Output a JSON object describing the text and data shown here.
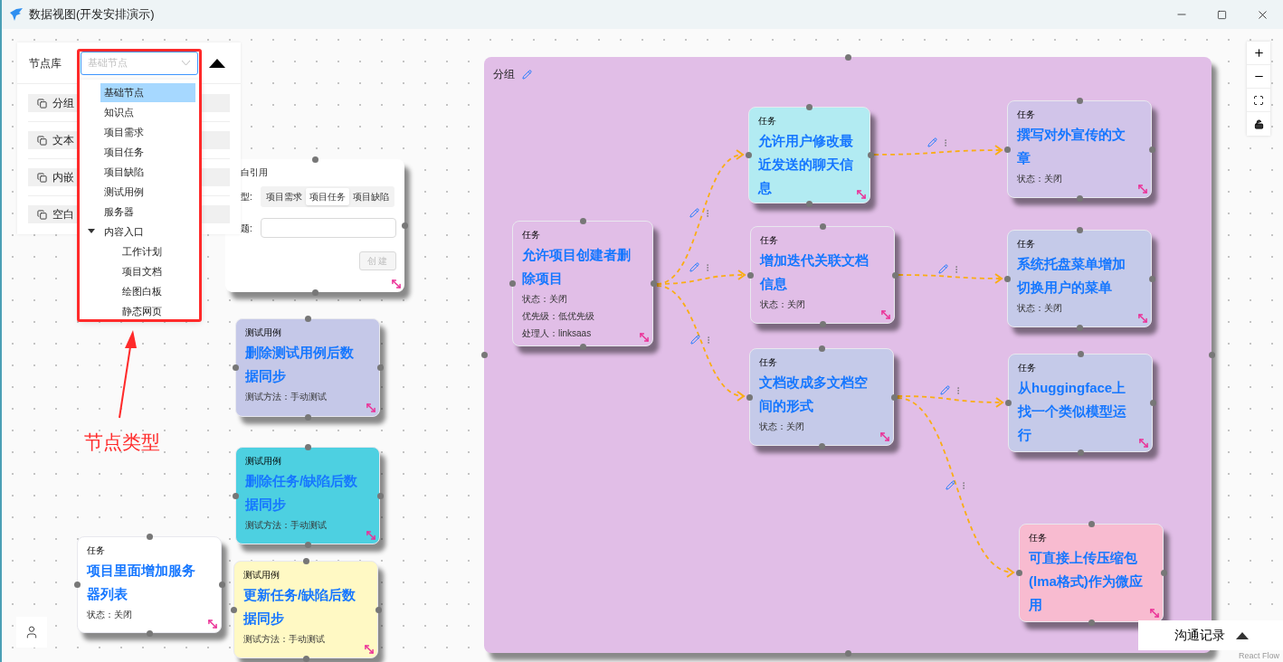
{
  "window": {
    "title": "数据视图(开发安排演示)"
  },
  "node_library": {
    "title": "节点库",
    "select": {
      "value": "基础节点"
    },
    "items": [
      {
        "label": "分组"
      },
      {
        "label": "文本"
      },
      {
        "label": "内嵌"
      },
      {
        "label": "空白"
      }
    ]
  },
  "type_dropdown": {
    "options": [
      {
        "label": "基础节点",
        "selected": true
      },
      {
        "label": "知识点",
        "selected": false
      },
      {
        "label": "项目需求",
        "selected": false
      },
      {
        "label": "项目任务",
        "selected": false
      },
      {
        "label": "项目缺陷",
        "selected": false
      },
      {
        "label": "测试用例",
        "selected": false
      },
      {
        "label": "服务器",
        "selected": false
      },
      {
        "label": "内容入口",
        "selected": false,
        "expanded": true,
        "children": [
          {
            "label": "工作计划",
            "selected": false
          },
          {
            "label": "项目文档",
            "selected": false
          },
          {
            "label": "绘图白板",
            "selected": false
          },
          {
            "label": "静态网页",
            "selected": false
          }
        ]
      }
    ]
  },
  "annotation": {
    "label": "节点类型"
  },
  "free_nodes": [
    {
      "kind": "ref_form",
      "title": "白引用",
      "type_label": "型:",
      "tabs": [
        {
          "label": "项目需求",
          "selected": false
        },
        {
          "label": "项目任务",
          "selected": true
        },
        {
          "label": "项目缺陷",
          "selected": false
        }
      ],
      "field_label": "题:",
      "button": {
        "label": "创建",
        "disabled": true
      }
    },
    {
      "kind": "test_case",
      "label": "测试用例",
      "title": "删除测试用例后数据同步",
      "lines": [
        "测试方法：手动测试"
      ],
      "color": "#c5c8e8"
    },
    {
      "kind": "test_case",
      "label": "测试用例",
      "title": "删除任务/缺陷后数据同步",
      "lines": [
        "测试方法：手动测试"
      ],
      "color": "#4dd0e1"
    },
    {
      "kind": "test_case",
      "label": "测试用例",
      "title": "更新任务/缺陷后数据同步",
      "lines": [
        "测试方法：手动测试"
      ],
      "color": "#fff9c4"
    },
    {
      "kind": "task",
      "label": "任务",
      "title": "项目里面增加服务器列表",
      "lines": [
        "状态：关闭"
      ],
      "color": "#ffffff"
    }
  ],
  "group": {
    "label": "分组",
    "color": "#e1bee7",
    "nodes": [
      {
        "kind": "task",
        "label": "任务",
        "title": "允许项目创建者删除项目",
        "lines": [
          "状态：关闭",
          "优先级：低优先级",
          "处理人：linksaas"
        ],
        "color": "#e1bee7"
      },
      {
        "kind": "task",
        "label": "任务",
        "title": "允许用户修改最近发送的聊天信息",
        "color": "#b2ebf2"
      },
      {
        "kind": "task",
        "label": "任务",
        "title": "增加迭代关联文档信息",
        "lines": [
          "状态：关闭"
        ],
        "color": "#e1bee7"
      },
      {
        "kind": "task",
        "label": "任务",
        "title": "文档改成多文档空间的形式",
        "lines": [
          "状态：关闭"
        ],
        "color": "#c5cae9"
      },
      {
        "kind": "task",
        "label": "任务",
        "title": "撰写对外宣传的文章",
        "lines": [
          "状态：关闭"
        ],
        "color": "#d1c4e9"
      },
      {
        "kind": "task",
        "label": "任务",
        "title": "系统托盘菜单增加切换用户的菜单",
        "lines": [
          "状态：关闭"
        ],
        "color": "#c5cae9"
      },
      {
        "kind": "task",
        "label": "任务",
        "title": "从huggingface上找一个类似模型运行",
        "color": "#c5cae9"
      },
      {
        "kind": "task",
        "label": "任务",
        "title": "可直接上传压缩包(lma格式)作为微应用",
        "color": "#f8bbd0"
      }
    ]
  },
  "comm_panel": {
    "label": "沟通记录"
  },
  "attribution": "React Flow"
}
